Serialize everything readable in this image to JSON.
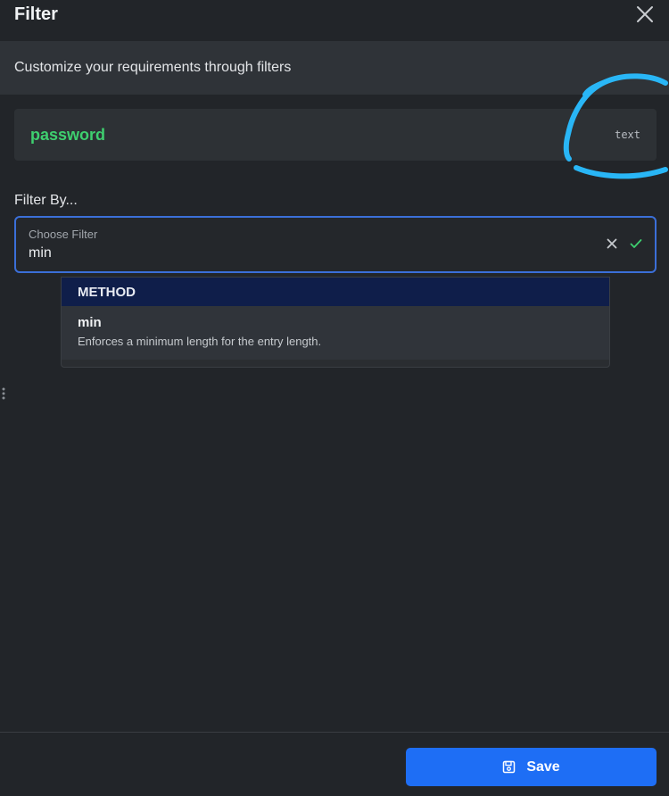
{
  "dialog": {
    "title": "Filter",
    "subtitle": "Customize your requirements through filters"
  },
  "field": {
    "name": "password",
    "type": "text"
  },
  "filter": {
    "label": "Filter By...",
    "select_label": "Choose Filter",
    "select_value": "min"
  },
  "dropdown": {
    "group_label": "METHOD",
    "options": [
      {
        "name": "min",
        "description": "Enforces a minimum length for the entry length."
      }
    ]
  },
  "footer": {
    "save_label": "Save"
  },
  "icons": {
    "close": "close-icon",
    "clear": "clear-icon",
    "confirm": "check-icon",
    "save": "floppy-disk-icon",
    "drag": "drag-handle-icon"
  },
  "colors": {
    "accent": "#1e6ef5",
    "field_name": "#3ecf6f",
    "confirm_check": "#3ecf6f",
    "group_header": "#0f1e4a",
    "annotation": "#29b6f6"
  }
}
